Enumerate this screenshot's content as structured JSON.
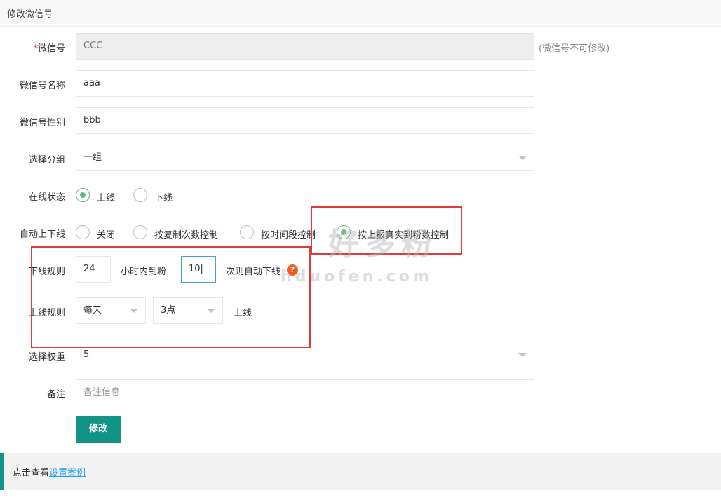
{
  "header": {
    "title": "修改微信号"
  },
  "form": {
    "wechat_id": {
      "required_mark": "*",
      "label": "微信号",
      "value": "CCC",
      "note": "(微信号不可修改)"
    },
    "wechat_name": {
      "label": "微信号名称",
      "value": "aaa"
    },
    "wechat_gender": {
      "label": "微信号性别",
      "value": "bbb"
    },
    "group": {
      "label": "选择分组",
      "selected": "一组"
    },
    "online_status": {
      "label": "在线状态",
      "options": [
        "上线",
        "下线"
      ],
      "selected_index": 0
    },
    "auto_toggle": {
      "label": "自动上下线",
      "options": [
        "关闭",
        "按复制次数控制",
        "按时间段控制",
        "按上报真实到粉数控制"
      ],
      "selected_index": 3
    },
    "offline_rule": {
      "label": "下线规则",
      "hours": "24",
      "text1": "小时内到粉",
      "count": "10",
      "text2": "次则自动下线",
      "help": "?"
    },
    "online_rule": {
      "label": "上线规则",
      "frequency": "每天",
      "time": "3点",
      "text": "上线"
    },
    "weight": {
      "label": "选择权重",
      "selected": "5"
    },
    "remark": {
      "label": "备注",
      "placeholder": "备注信息"
    },
    "submit_label": "修改"
  },
  "footer": {
    "text": "点击查看",
    "link": "设置案例"
  },
  "watermark": {
    "big": "好多粉",
    "small": "hduofen.com"
  },
  "colors": {
    "primary": "#119485",
    "radio_active": "#5fb878",
    "highlight": "#e03a3a",
    "link": "#1e9fff",
    "help_icon": "#f25c1f"
  }
}
